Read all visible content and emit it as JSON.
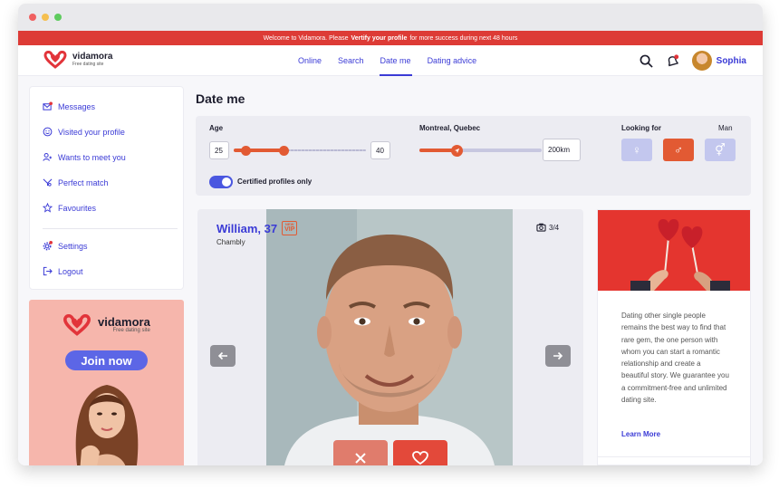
{
  "banner": {
    "text_before": "Welcome to Vidamora. Please",
    "text_bold": "Vertify your profile",
    "text_after": "for more success during next 48 hours"
  },
  "brand": {
    "name": "vidamora",
    "tagline": "Free dating site"
  },
  "nav": {
    "links": [
      "Online",
      "Search",
      "Date me",
      "Dating advice"
    ],
    "active": "Date me",
    "user_name": "Sophia"
  },
  "sidebar": {
    "items": [
      "Messages",
      "Visited your profile",
      "Wants to meet you",
      "Perfect match",
      "Favourites"
    ],
    "bottom_items": [
      "Settings",
      "Logout"
    ]
  },
  "ad": {
    "cta": "Join now"
  },
  "page": {
    "title": "Date me"
  },
  "filters": {
    "age_label": "Age",
    "age_min": "25",
    "age_max": "40",
    "location_label": "Montreal, Quebec",
    "distance": "200km",
    "distance_fraction": 0.3,
    "looking_for_label": "Looking for",
    "looking_for_value": "Man",
    "certified_label": "Certified profiles only",
    "certified_on": true
  },
  "profile": {
    "name_age": "William, 37",
    "vip_small": "NEW",
    "vip": "VIP",
    "city": "Chambly",
    "photo_count": "3/4"
  },
  "promo": {
    "text": "Dating other single people remains the best way to find that rare gem, the one person with whom you can start a romantic relationship and create a beautiful story. We guarantee you a commitment-free and unlimited dating site.",
    "link": "Learn More"
  },
  "colors": {
    "accent": "#3b3bd6",
    "brand_red": "#dd3b36",
    "slider": "#e25a33"
  }
}
